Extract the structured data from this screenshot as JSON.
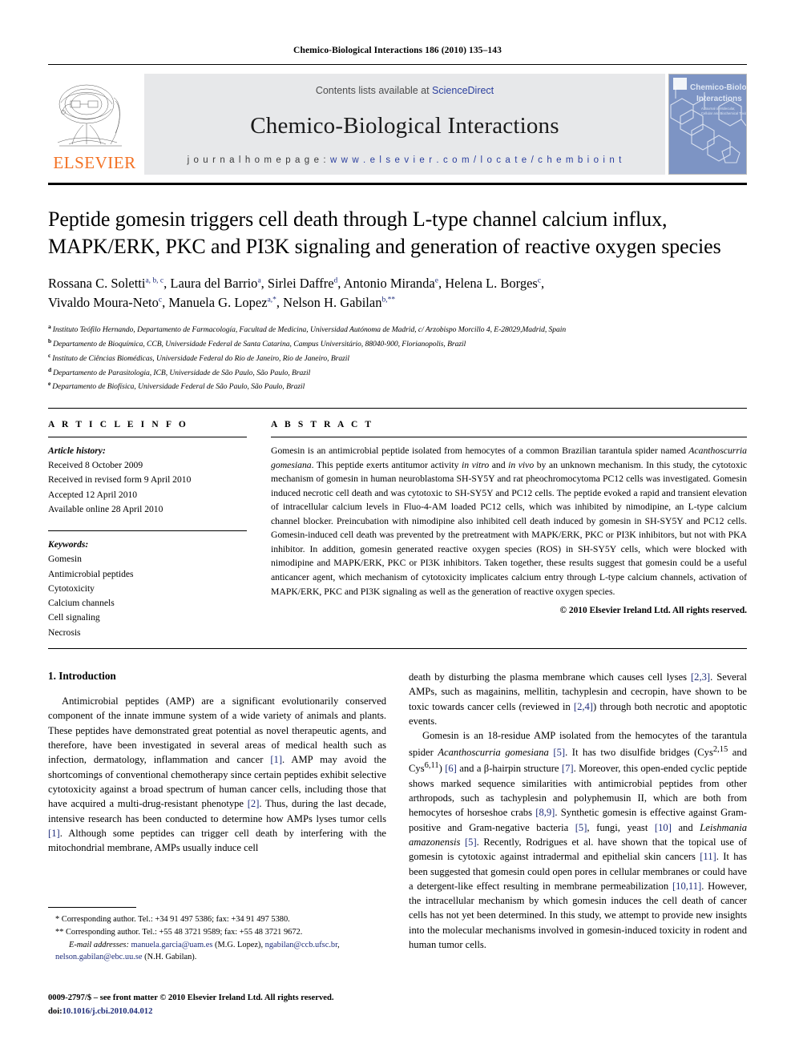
{
  "running_head": "Chemico-Biological Interactions 186 (2010) 135–143",
  "masthead": {
    "publisher_logo_text": "ELSEVIER",
    "contents_prefix": "Contents lists available at ",
    "contents_link": "ScienceDirect",
    "journal_title": "Chemico-Biological Interactions",
    "homepage_prefix": "j o u r n a l   h o m e p a g e :   ",
    "homepage_url": "w w w . e l s e v i e r . c o m / l o c a t e / c h e m b i o i n t",
    "cover_line1": "Chemico-Biological",
    "cover_line2": "Interactions",
    "cover_sub1": "A Journal of Molecular,",
    "cover_sub2": "Cellular and Biochemical Toxicology"
  },
  "article": {
    "title": "Peptide gomesin triggers cell death through L-type channel calcium influx, MAPK/ERK, PKC and PI3K signaling and generation of reactive oxygen species",
    "authors_line1_pre": "Rossana C. Soletti",
    "authors": "Rossana C. Soletti a,b,c, Laura del Barrio a, Sirlei Daffre d, Antonio Miranda e, Helena L. Borges c, Vivaldo Moura-Neto c, Manuela G. Lopez a,*, Nelson H. Gabilan b,**",
    "affiliations": [
      {
        "marker": "a",
        "text": "Instituto Teófilo Hernando, Departamento de Farmacología, Facultad de Medicina, Universidad Autónoma de Madrid, c/ Arzobispo Morcillo 4, E-28029,Madrid, Spain"
      },
      {
        "marker": "b",
        "text": "Departamento de Bioquímica, CCB, Universidade Federal de Santa Catarina, Campus Universitário, 88040-900, Florianopolis, Brazil"
      },
      {
        "marker": "c",
        "text": "Instituto de Ciências Biomédicas, Universidade Federal do Rio de Janeiro, Rio de Janeiro, Brazil"
      },
      {
        "marker": "d",
        "text": "Departamento de Parasitologia, ICB, Universidade de São Paulo, São Paulo, Brazil"
      },
      {
        "marker": "e",
        "text": "Departamento de Biofísica, Universidade Federal de São Paulo, São Paulo, Brazil"
      }
    ]
  },
  "article_info": {
    "heading": "A R T I C L E    I N F O",
    "history_label": "Article history:",
    "history": [
      "Received 8 October 2009",
      "Received in revised form 9 April 2010",
      "Accepted 12 April 2010",
      "Available online 28 April 2010"
    ],
    "keywords_label": "Keywords:",
    "keywords": [
      "Gomesin",
      "Antimicrobial peptides",
      "Cytotoxicity",
      "Calcium channels",
      "Cell signaling",
      "Necrosis"
    ]
  },
  "abstract": {
    "heading": "A B S T R A C T",
    "text": "Gomesin is an antimicrobial peptide isolated from hemocytes of a common Brazilian tarantula spider named Acanthoscurria gomesiana. This peptide exerts antitumor activity in vitro and in vivo by an unknown mechanism. In this study, the cytotoxic mechanism of gomesin in human neuroblastoma SH-SY5Y and rat pheochromocytoma PC12 cells was investigated. Gomesin induced necrotic cell death and was cytotoxic to SH-SY5Y and PC12 cells. The peptide evoked a rapid and transient elevation of intracellular calcium levels in Fluo-4-AM loaded PC12 cells, which was inhibited by nimodipine, an L-type calcium channel blocker. Preincubation with nimodipine also inhibited cell death induced by gomesin in SH-SY5Y and PC12 cells. Gomesin-induced cell death was prevented by the pretreatment with MAPK/ERK, PKC or PI3K inhibitors, but not with PKA inhibitor. In addition, gomesin generated reactive oxygen species (ROS) in SH-SY5Y cells, which were blocked with nimodipine and MAPK/ERK, PKC or PI3K inhibitors. Taken together, these results suggest that gomesin could be a useful anticancer agent, which mechanism of cytotoxicity implicates calcium entry through L-type calcium channels, activation of MAPK/ERK, PKC and PI3K signaling as well as the generation of reactive oxygen species.",
    "copyright": "© 2010 Elsevier Ireland Ltd. All rights reserved."
  },
  "introduction": {
    "heading": "1.  Introduction",
    "para1": "Antimicrobial peptides (AMP) are a significant evolutionarily conserved component of the innate immune system of a wide variety of animals and plants. These peptides have demonstrated great potential as novel therapeutic agents, and therefore, have been investigated in several areas of medical health such as infection, dermatology, inflammation and cancer [1]. AMP may avoid the shortcomings of conventional chemotherapy since certain peptides exhibit selective cytotoxicity against a broad spectrum of human cancer cells, including those that have acquired a multi-drug-resistant phenotype [2]. Thus, during the last decade, intensive research has been conducted to determine how AMPs lyses tumor cells [1]. Although some peptides can trigger cell death by interfering with the mitochondrial membrane, AMPs usually induce cell death by disturbing the plasma membrane which causes cell lyses [2,3]. Several AMPs, such as magainins, mellitin, tachyplesin and cecropin, have shown to be toxic towards cancer cells (reviewed in [2,4]) through both necrotic and apoptotic events.",
    "para2": "Gomesin is an 18-residue AMP isolated from the hemocytes of the tarantula spider Acanthoscurria gomesiana [5]. It has two disulfide bridges (Cys2,15 and Cys6,11) [6] and a β-hairpin structure [7]. Moreover, this open-ended cyclic peptide shows marked sequence similarities with antimicrobial peptides from other arthropods, such as tachyplesin and polyphemusin II, which are both from hemocytes of horseshoe crabs [8,9]. Synthetic gomesin is effective against Gram-positive and Gram-negative bacteria [5], fungi, yeast [10] and Leishmania amazonensis [5]. Recently, Rodrigues et al. have shown that the topical use of gomesin is cytotoxic against intradermal and epithelial skin cancers [11]. It has been suggested that gomesin could open pores in cellular membranes or could have a detergent-like effect resulting in membrane permeabilization [10,11]. However, the intracellular mechanism by which gomesin induces the cell death of cancer cells has not yet been determined. In this study, we attempt to provide new insights into the molecular mechanisms involved in gomesin-induced toxicity in rodent and human tumor cells."
  },
  "footnotes": {
    "corr1": "* Corresponding author. Tel.: +34 91 497 5386; fax: +34 91 497 5380.",
    "corr2": "** Corresponding author. Tel.: +55 48 3721 9589; fax: +55 48 3721 9672.",
    "email_label": "E-mail addresses:",
    "email1": "manuela.garcia@uam.es",
    "email1_owner": " (M.G. Lopez), ",
    "email2": "ngabilan@ccb.ufsc.br",
    "email2_sep": ", ",
    "email3": "nelson.gabilan@ebc.uu.se",
    "email3_owner": " (N.H. Gabilan)."
  },
  "imprint": {
    "line1": "0009-2797/$ – see front matter © 2010 Elsevier Ireland Ltd. All rights reserved.",
    "doi_label": "doi:",
    "doi": "10.1016/j.cbi.2010.04.012"
  },
  "colors": {
    "link": "#2b3f9e",
    "reference": "#1f2d7a",
    "elsevier_orange": "#f37021",
    "band_gray": "#e7e8ea",
    "cover_blue": "#7d94c4"
  }
}
